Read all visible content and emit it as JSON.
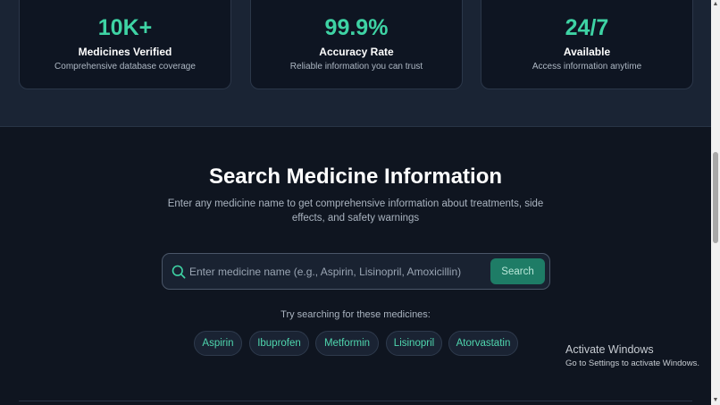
{
  "stats": [
    {
      "value": "10K+",
      "label": "Medicines Verified",
      "desc": "Comprehensive database coverage"
    },
    {
      "value": "99.9%",
      "label": "Accuracy Rate",
      "desc": "Reliable information you can trust"
    },
    {
      "value": "24/7",
      "label": "Available",
      "desc": "Access information anytime"
    }
  ],
  "search": {
    "title": "Search Medicine Information",
    "desc": "Enter any medicine name to get comprehensive information about treatments, side effects, and safety warnings",
    "placeholder": "Enter medicine name (e.g., Aspirin, Lisinopril, Amoxicillin)",
    "button_label": "Search",
    "suggest_label": "Try searching for these medicines:",
    "chips": [
      "Aspirin",
      "Ibuprofen",
      "Metformin",
      "Lisinopril",
      "Atorvastatin"
    ]
  },
  "watermark": {
    "title": "Activate Windows",
    "sub": "Go to Settings to activate Windows."
  },
  "colors": {
    "accent": "#3ed3a4",
    "button": "#1e7c66",
    "background": "#0f1520"
  },
  "icons": {
    "search": "search-icon"
  }
}
